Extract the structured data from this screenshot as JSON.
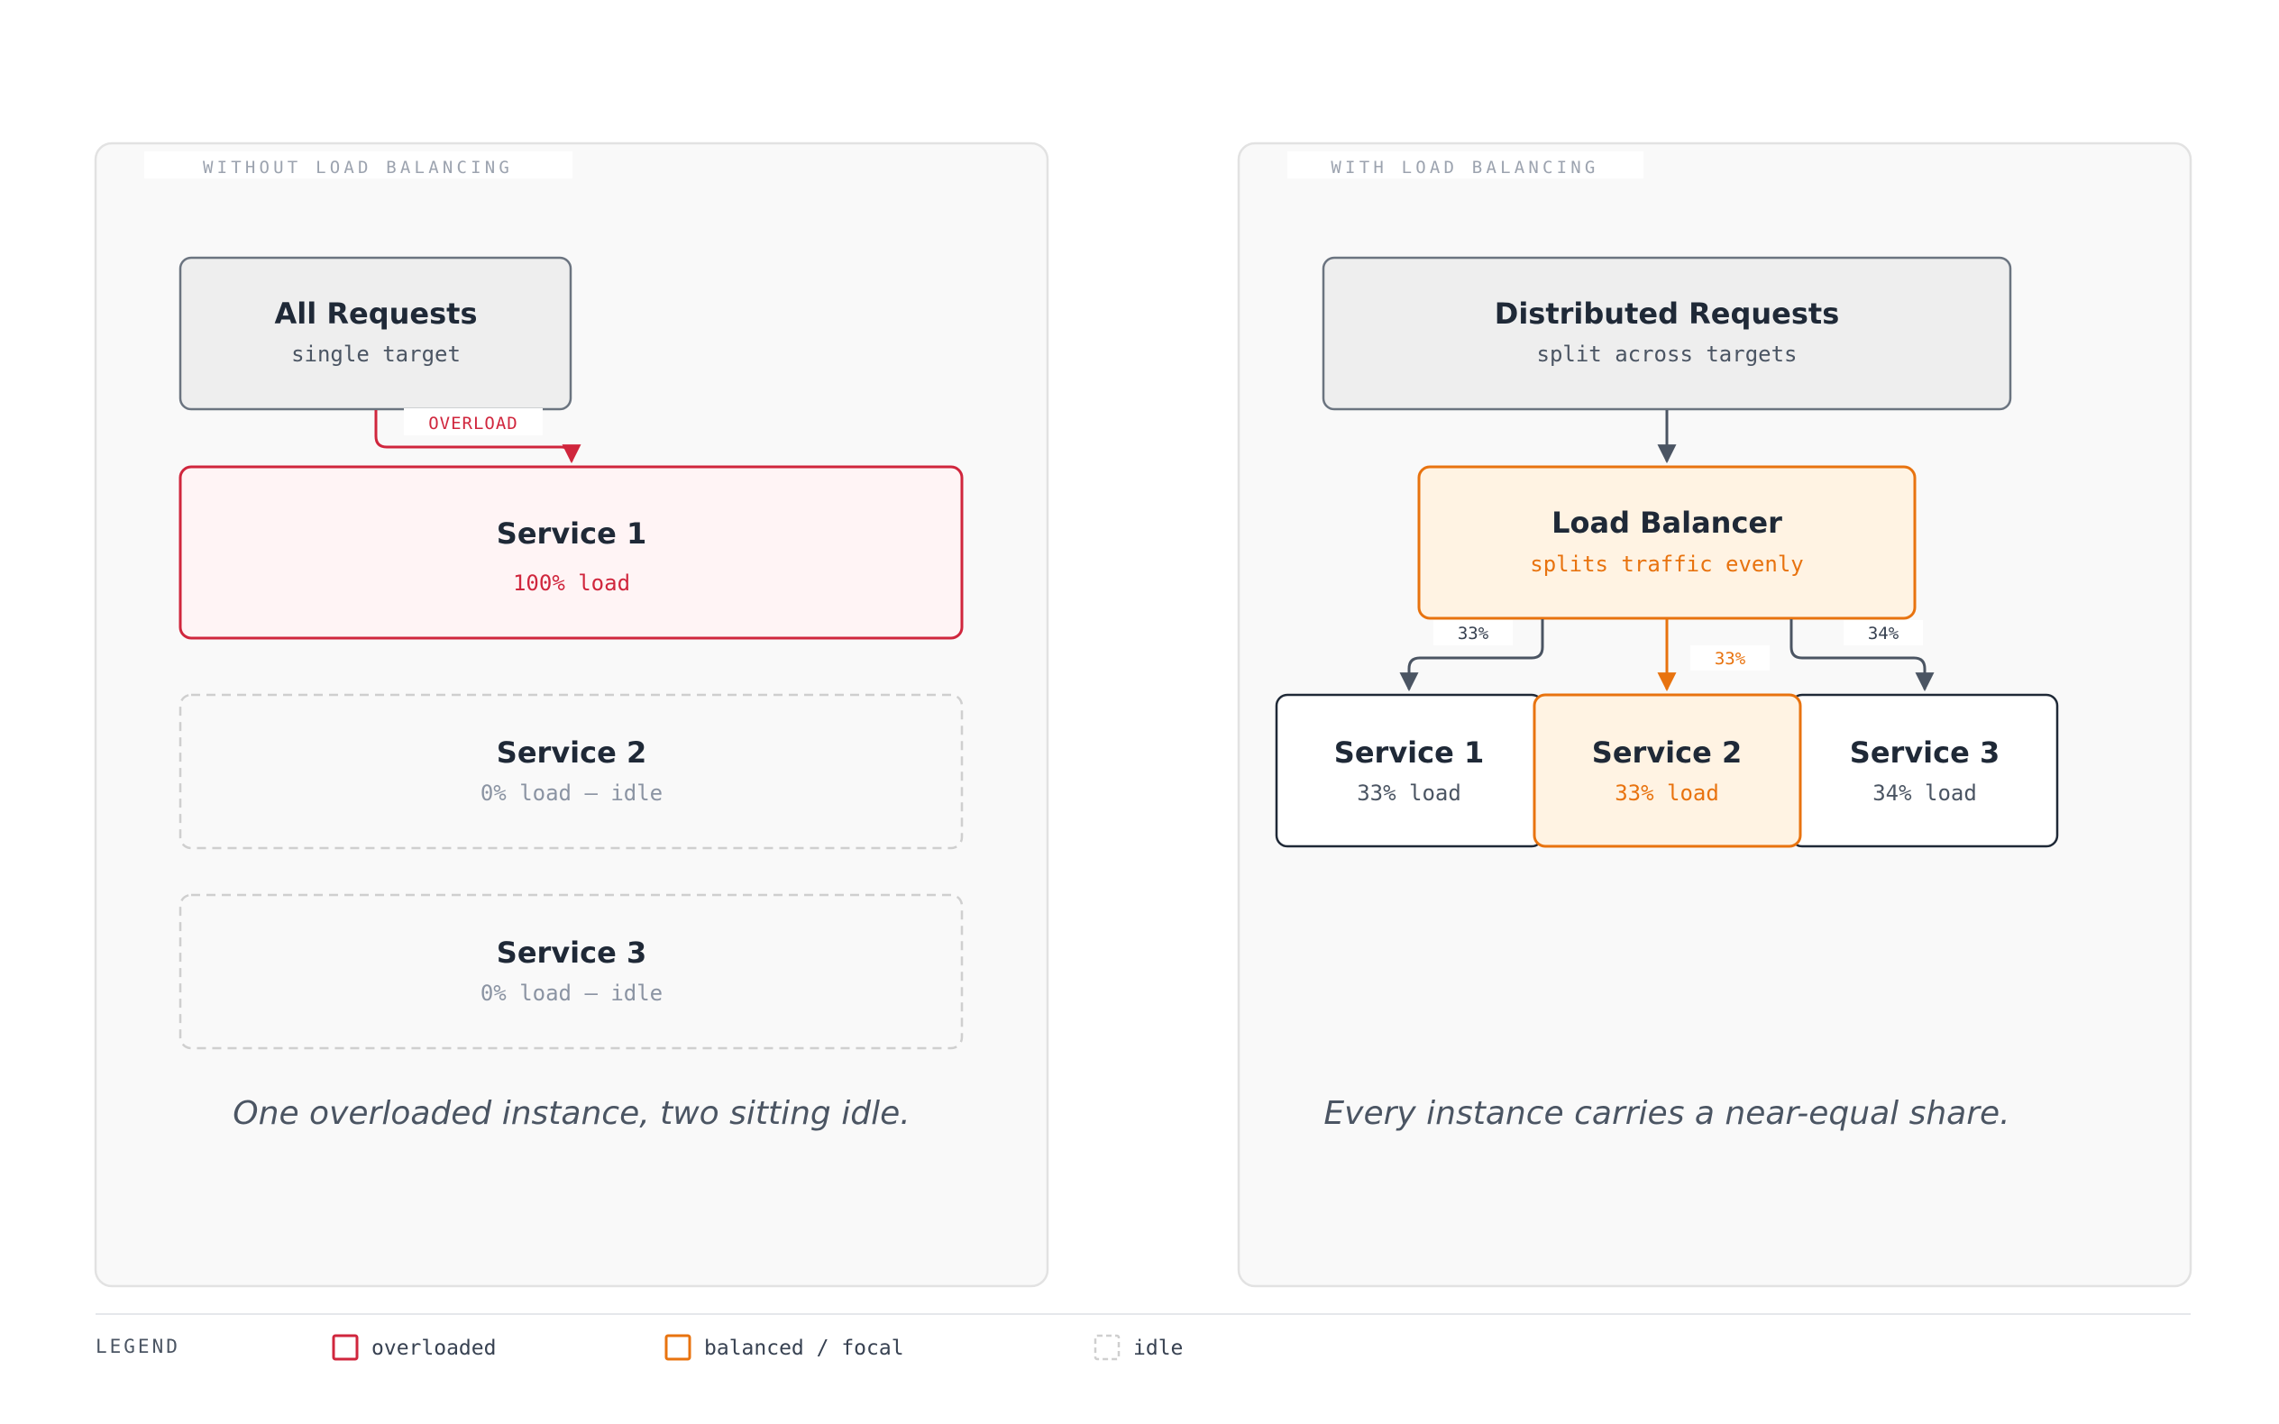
{
  "left_panel": {
    "tag": "WITHOUT LOAD BALANCING",
    "source": {
      "title": "All Requests",
      "subtitle": "single target"
    },
    "edge_label": "OVERLOAD",
    "services": [
      {
        "title": "Service 1",
        "subtitle": "100% load",
        "state": "overloaded"
      },
      {
        "title": "Service 2",
        "subtitle": "0% load — idle",
        "state": "idle"
      },
      {
        "title": "Service 3",
        "subtitle": "0% load — idle",
        "state": "idle"
      }
    ],
    "caption": "One overloaded instance, two sitting idle."
  },
  "right_panel": {
    "tag": "WITH LOAD BALANCING",
    "source": {
      "title": "Distributed Requests",
      "subtitle": "split across targets"
    },
    "balancer": {
      "title": "Load Balancer",
      "subtitle": "splits traffic evenly"
    },
    "edge_labels": [
      "33%",
      "33%",
      "34%"
    ],
    "services": [
      {
        "title": "Service 1",
        "subtitle": "33% load",
        "state": "balanced"
      },
      {
        "title": "Service 2",
        "subtitle": "33% load",
        "state": "focal"
      },
      {
        "title": "Service 3",
        "subtitle": "34% load",
        "state": "balanced"
      }
    ],
    "caption": "Every instance carries a near-equal share."
  },
  "legend": {
    "title": "LEGEND",
    "items": [
      {
        "label": "overloaded",
        "color": "#d0263d",
        "style": "solid"
      },
      {
        "label": "balanced / focal",
        "color": "#e8730f",
        "style": "solid"
      },
      {
        "label": "idle",
        "color": "#cfcfcf",
        "style": "dashed"
      }
    ]
  },
  "colors": {
    "overloaded": "#d0263d",
    "focal": "#e8730f",
    "neutral_stroke": "#6b7480",
    "text": "#1f2937"
  }
}
